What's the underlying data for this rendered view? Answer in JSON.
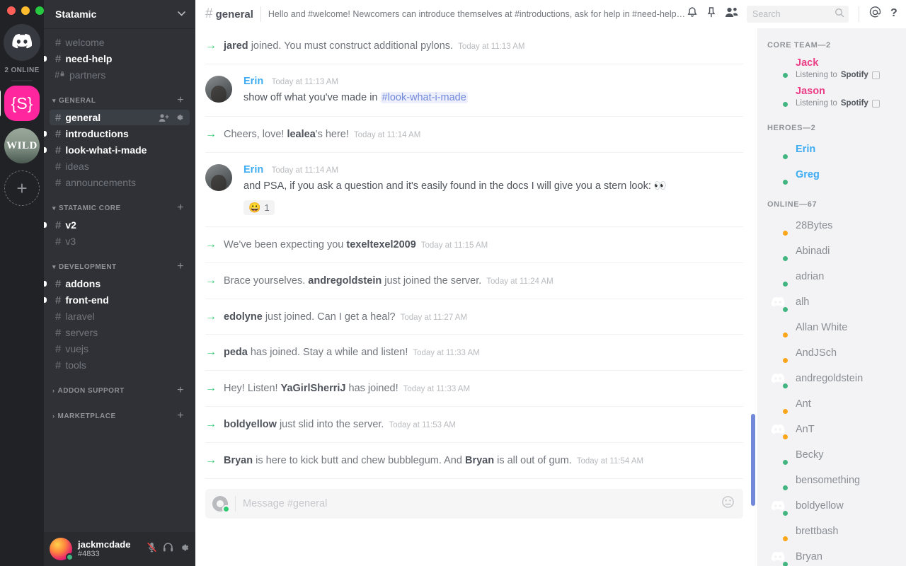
{
  "window": {
    "traffic_lights": [
      "close",
      "minimize",
      "maximize"
    ]
  },
  "guild_rail": {
    "home_icon": "discord-logo-icon",
    "online_label": "2 ONLINE",
    "servers": [
      {
        "name": "Statamic",
        "glyph": "{S}",
        "active": true
      },
      {
        "name": "Wild",
        "glyph": "WILD",
        "active": false
      }
    ],
    "add_server_label": "+"
  },
  "sidebar": {
    "guild_name": "Statamic",
    "collapse_icon": "chevron-down-icon",
    "top_channels": [
      {
        "name": "welcome",
        "state": "read",
        "locked": false
      },
      {
        "name": "need-help",
        "state": "unread",
        "locked": false
      },
      {
        "name": "partners",
        "state": "read",
        "locked": true
      }
    ],
    "categories": [
      {
        "label": "GENERAL",
        "expanded": true,
        "add_label": "+",
        "channels": [
          {
            "name": "general",
            "state": "active",
            "actions": [
              "add-member-icon",
              "gear-icon"
            ]
          },
          {
            "name": "introductions",
            "state": "unread"
          },
          {
            "name": "look-what-i-made",
            "state": "unread"
          },
          {
            "name": "ideas",
            "state": "read"
          },
          {
            "name": "announcements",
            "state": "read"
          }
        ]
      },
      {
        "label": "STATAMIC CORE",
        "expanded": true,
        "add_label": "+",
        "channels": [
          {
            "name": "v2",
            "state": "unread"
          },
          {
            "name": "v3",
            "state": "read"
          }
        ]
      },
      {
        "label": "DEVELOPMENT",
        "expanded": true,
        "add_label": "+",
        "channels": [
          {
            "name": "addons",
            "state": "unread"
          },
          {
            "name": "front-end",
            "state": "unread"
          },
          {
            "name": "laravel",
            "state": "read"
          },
          {
            "name": "servers",
            "state": "read"
          },
          {
            "name": "vuejs",
            "state": "read"
          },
          {
            "name": "tools",
            "state": "read"
          }
        ]
      },
      {
        "label": "ADDON SUPPORT",
        "expanded": false,
        "add_label": "+",
        "channels": []
      },
      {
        "label": "MARKETPLACE",
        "expanded": false,
        "add_label": "+",
        "channels": []
      }
    ],
    "user": {
      "name": "jackmcdade",
      "discriminator": "#4833",
      "status": "online",
      "controls": [
        "mute-icon",
        "deafen-icon",
        "settings-gear-icon"
      ]
    }
  },
  "topbar": {
    "hash": "#",
    "channel": "general",
    "topic": "Hello and #welcome! Newcomers can introduce themselves at #introductions, ask for help in #need-help, and ge...",
    "icons": [
      "bell-icon",
      "pin-icon",
      "members-icon"
    ],
    "search": {
      "placeholder": "Search",
      "value": "",
      "icon": "search-icon"
    },
    "mentions_icon": "at-icon",
    "help_icon": "help-icon"
  },
  "messages": [
    {
      "type": "system",
      "parts": [
        {
          "t": "name",
          "v": "jared"
        },
        {
          "t": "text",
          "v": " joined. You must construct additional pylons."
        }
      ],
      "timestamp": "Today at 11:13 AM"
    },
    {
      "type": "user",
      "author": "Erin",
      "timestamp": "Today at 11:13 AM",
      "body_parts": [
        {
          "t": "text",
          "v": "show off what you've made in "
        },
        {
          "t": "mention",
          "v": "#look-what-i-made"
        }
      ]
    },
    {
      "type": "system",
      "parts": [
        {
          "t": "text",
          "v": "Cheers, love! "
        },
        {
          "t": "name",
          "v": "lealea"
        },
        {
          "t": "text",
          "v": "'s here!"
        }
      ],
      "timestamp": "Today at 11:14 AM"
    },
    {
      "type": "user",
      "author": "Erin",
      "timestamp": "Today at 11:14 AM",
      "body_parts": [
        {
          "t": "text",
          "v": "and PSA, if you ask a question and it's easily found in the docs I will give you a stern look: 👀"
        }
      ],
      "reaction": {
        "emoji": "😀",
        "count": "1"
      }
    },
    {
      "type": "system",
      "parts": [
        {
          "t": "text",
          "v": "We've been expecting you "
        },
        {
          "t": "name",
          "v": "texeltexel2009"
        }
      ],
      "timestamp": "Today at 11:15 AM"
    },
    {
      "type": "system",
      "parts": [
        {
          "t": "text",
          "v": "Brace yourselves. "
        },
        {
          "t": "name",
          "v": "andregoldstein"
        },
        {
          "t": "text",
          "v": " just joined the server."
        }
      ],
      "timestamp": "Today at 11:24 AM"
    },
    {
      "type": "system",
      "parts": [
        {
          "t": "name",
          "v": "edolyne"
        },
        {
          "t": "text",
          "v": " just joined. Can I get a heal?"
        }
      ],
      "timestamp": "Today at 11:27 AM"
    },
    {
      "type": "system",
      "parts": [
        {
          "t": "name",
          "v": "peda"
        },
        {
          "t": "text",
          "v": " has joined. Stay a while and listen!"
        }
      ],
      "timestamp": "Today at 11:33 AM"
    },
    {
      "type": "system",
      "parts": [
        {
          "t": "text",
          "v": "Hey! Listen! "
        },
        {
          "t": "name",
          "v": "YaGirlSherriJ"
        },
        {
          "t": "text",
          "v": " has joined!"
        }
      ],
      "timestamp": "Today at 11:33 AM"
    },
    {
      "type": "system",
      "parts": [
        {
          "t": "name",
          "v": "boldyellow"
        },
        {
          "t": "text",
          "v": " just slid into the server."
        }
      ],
      "timestamp": "Today at 11:53 AM"
    },
    {
      "type": "system",
      "parts": [
        {
          "t": "name",
          "v": "Bryan"
        },
        {
          "t": "text",
          "v": " is here to kick butt and chew bubblegum. And "
        },
        {
          "t": "name",
          "v": "Bryan"
        },
        {
          "t": "text",
          "v": " is all out of gum."
        }
      ],
      "timestamp": "Today at 11:54 AM"
    }
  ],
  "composer": {
    "placeholder": "Message #general",
    "value": "",
    "upload_icon": "upload-plus-icon",
    "emoji_icon": "emoji-picker-icon"
  },
  "members": {
    "groups": [
      {
        "label": "CORE TEAM—2",
        "people": [
          {
            "name": "Jack",
            "color": "pink",
            "status": "online",
            "activity_prefix": "Listening to",
            "activity_app": "Spotify",
            "activity_icon": "spotify-badge-icon",
            "avatar": "photo-jack"
          },
          {
            "name": "Jason",
            "color": "pink",
            "status": "online",
            "activity_prefix": "Listening to",
            "activity_app": "Spotify",
            "activity_icon": "spotify-badge-icon",
            "avatar": "photo-jason"
          }
        ]
      },
      {
        "label": "HEROES—2",
        "people": [
          {
            "name": "Erin",
            "color": "blue",
            "status": "online",
            "avatar": "photo-erin"
          },
          {
            "name": "Greg",
            "color": "blue",
            "status": "online",
            "avatar": "photo-greg"
          }
        ]
      },
      {
        "label": "ONLINE—67",
        "people": [
          {
            "name": "28Bytes",
            "color": "gray",
            "status": "idle",
            "avatar": "photo-28bytes"
          },
          {
            "name": "Abinadi",
            "color": "gray",
            "status": "online",
            "avatar": "photo-abinadi"
          },
          {
            "name": "adrian",
            "color": "gray",
            "status": "online",
            "avatar": "photo-adrian"
          },
          {
            "name": "alh",
            "color": "gray",
            "status": "online",
            "avatar": "clyde-red"
          },
          {
            "name": "Allan White",
            "color": "gray",
            "status": "idle",
            "avatar": "photo-allan"
          },
          {
            "name": "AndJSch",
            "color": "gray",
            "status": "idle",
            "avatar": "photo-andjsch"
          },
          {
            "name": "andregoldstein",
            "color": "gray",
            "status": "online",
            "avatar": "clyde-blurple"
          },
          {
            "name": "Ant",
            "color": "gray",
            "status": "idle",
            "avatar": "photo-ant"
          },
          {
            "name": "AnT",
            "color": "gray",
            "status": "idle",
            "avatar": "clyde-red"
          },
          {
            "name": "Becky",
            "color": "gray",
            "status": "online",
            "avatar": "photo-becky"
          },
          {
            "name": "bensomething",
            "color": "gray",
            "status": "online",
            "avatar": "photo-ben"
          },
          {
            "name": "boldyellow",
            "color": "gray",
            "status": "online",
            "avatar": "clyde-gray"
          },
          {
            "name": "brettbash",
            "color": "gray",
            "status": "idle",
            "avatar": "photo-brett"
          },
          {
            "name": "Bryan",
            "color": "gray",
            "status": "online",
            "avatar": "clyde-red"
          }
        ]
      }
    ]
  },
  "colors": {
    "rail_bg": "#202225",
    "sidebar_bg": "#2f3136",
    "accent_blurple": "#7289da",
    "statamic_pink": "#ff269e",
    "online_green": "#43b581",
    "idle_orange": "#faa61a",
    "system_arrow_green": "#2ecc71",
    "link_blue": "#3eacf3",
    "role_pink": "#ea3f87"
  }
}
